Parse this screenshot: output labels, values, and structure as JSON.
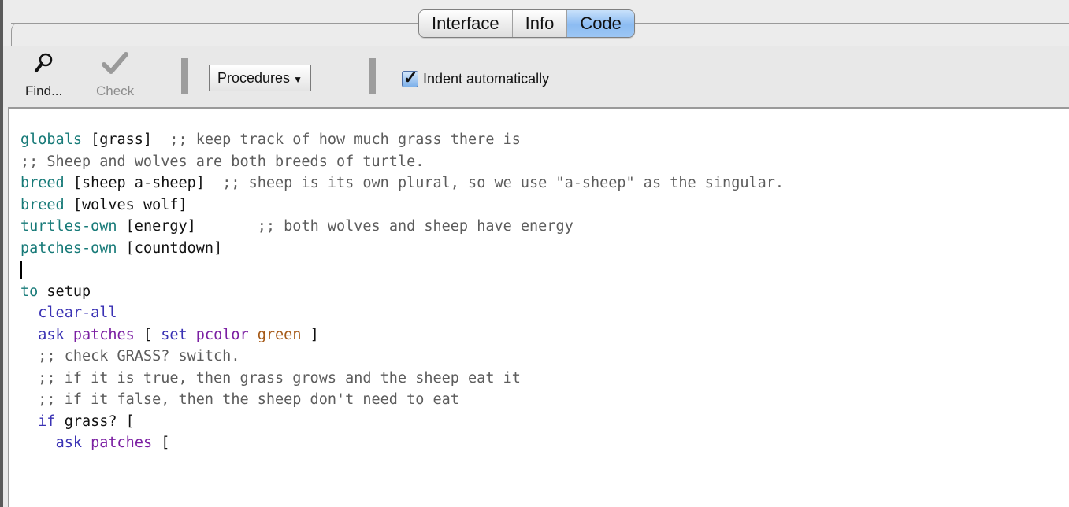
{
  "colors": {
    "keyword": "#177a78",
    "command": "#3a32b4",
    "reporter": "#7b1fa2",
    "constant": "#a65a18",
    "comment": "#5c5c5c",
    "plain": "#111111",
    "active_tab": "#9cc6f4"
  },
  "tabs": [
    {
      "label": "Interface",
      "active": false
    },
    {
      "label": "Info",
      "active": false
    },
    {
      "label": "Code",
      "active": true
    }
  ],
  "toolbar": {
    "find_label": "Find...",
    "find_icon": "magnifier-icon",
    "check_label": "Check",
    "check_icon": "checkmark-icon",
    "procedures_label": "Procedures",
    "indent_label": "Indent automatically",
    "indent_checked": true
  },
  "code_lines": [
    [
      {
        "t": "globals",
        "c": "keyword"
      },
      {
        "t": " [grass]  ",
        "c": "plain"
      },
      {
        "t": ";; keep track of how much grass there is",
        "c": "comment"
      }
    ],
    [
      {
        "t": ";; Sheep and wolves are both breeds of turtle.",
        "c": "comment"
      }
    ],
    [
      {
        "t": "breed",
        "c": "keyword"
      },
      {
        "t": " [sheep a-sheep]  ",
        "c": "plain"
      },
      {
        "t": ";; sheep is its own plural, so we use \"a-sheep\" as the singular.",
        "c": "comment"
      }
    ],
    [
      {
        "t": "breed",
        "c": "keyword"
      },
      {
        "t": " [wolves wolf]",
        "c": "plain"
      }
    ],
    [
      {
        "t": "turtles-own",
        "c": "keyword"
      },
      {
        "t": " [energy]       ",
        "c": "plain"
      },
      {
        "t": ";; both wolves and sheep have energy",
        "c": "comment"
      }
    ],
    [
      {
        "t": "patches-own",
        "c": "keyword"
      },
      {
        "t": " [countdown]",
        "c": "plain"
      }
    ],
    [
      {
        "t": "",
        "c": "plain"
      }
    ],
    [
      {
        "t": "to",
        "c": "keyword"
      },
      {
        "t": " setup",
        "c": "plain"
      }
    ],
    [
      {
        "t": "  ",
        "c": "plain"
      },
      {
        "t": "clear-all",
        "c": "command"
      }
    ],
    [
      {
        "t": "  ",
        "c": "plain"
      },
      {
        "t": "ask",
        "c": "command"
      },
      {
        "t": " ",
        "c": "plain"
      },
      {
        "t": "patches",
        "c": "reporter"
      },
      {
        "t": " [ ",
        "c": "plain"
      },
      {
        "t": "set",
        "c": "command"
      },
      {
        "t": " ",
        "c": "plain"
      },
      {
        "t": "pcolor",
        "c": "reporter"
      },
      {
        "t": " ",
        "c": "plain"
      },
      {
        "t": "green",
        "c": "constant"
      },
      {
        "t": " ]",
        "c": "plain"
      }
    ],
    [
      {
        "t": "  ",
        "c": "plain"
      },
      {
        "t": ";; check GRASS? switch.",
        "c": "comment"
      }
    ],
    [
      {
        "t": "  ",
        "c": "plain"
      },
      {
        "t": ";; if it is true, then grass grows and the sheep eat it",
        "c": "comment"
      }
    ],
    [
      {
        "t": "  ",
        "c": "plain"
      },
      {
        "t": ";; if it false, then the sheep don't need to eat",
        "c": "comment"
      }
    ],
    [
      {
        "t": "  ",
        "c": "plain"
      },
      {
        "t": "if",
        "c": "command"
      },
      {
        "t": " grass? [",
        "c": "plain"
      }
    ],
    [
      {
        "t": "    ",
        "c": "plain"
      },
      {
        "t": "ask",
        "c": "command"
      },
      {
        "t": " ",
        "c": "plain"
      },
      {
        "t": "patches",
        "c": "reporter"
      },
      {
        "t": " [",
        "c": "plain"
      }
    ]
  ]
}
